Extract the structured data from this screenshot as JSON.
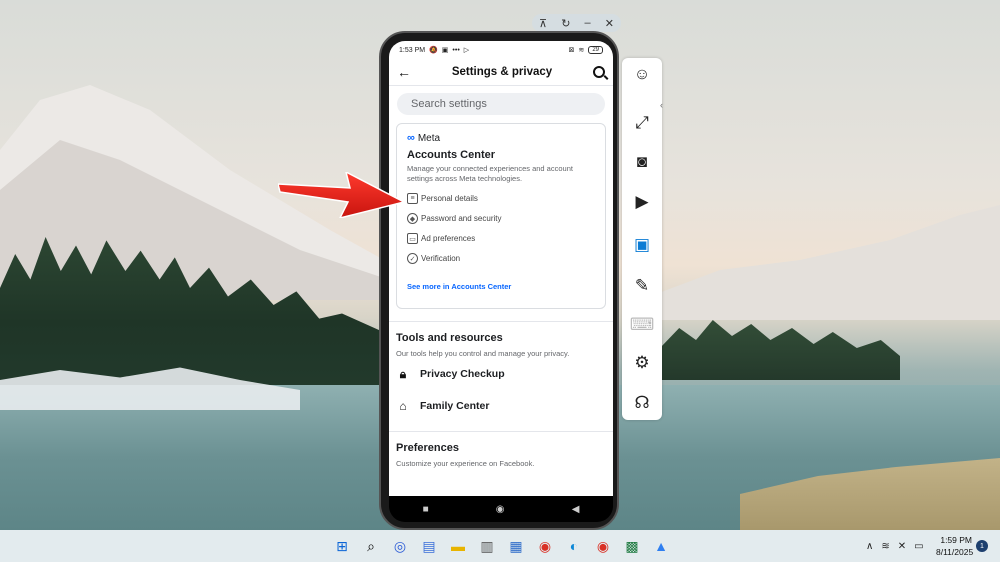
{
  "phone_window": {
    "top_controls": [
      "pin-icon",
      "rotate-icon",
      "minimize-icon",
      "close-icon"
    ]
  },
  "statusbar": {
    "time": "1:53 PM",
    "battery": "29"
  },
  "header": {
    "title": "Settings & privacy"
  },
  "search": {
    "placeholder": "Search settings"
  },
  "accounts_center": {
    "brand": "Meta",
    "title": "Accounts Center",
    "description": "Manage your connected experiences and account settings across Meta technologies.",
    "items": [
      {
        "label": "Personal details",
        "icon": "id-card-icon"
      },
      {
        "label": "Password and security",
        "icon": "shield-icon"
      },
      {
        "label": "Ad preferences",
        "icon": "monitor-icon"
      },
      {
        "label": "Verification",
        "icon": "check-badge-icon"
      }
    ],
    "link": "See more in Accounts Center"
  },
  "tools": {
    "title": "Tools and resources",
    "description": "Our tools help you control and manage your privacy.",
    "items": [
      {
        "label": "Privacy Checkup",
        "icon": "lock-icon"
      },
      {
        "label": "Family Center",
        "icon": "home-people-icon"
      }
    ]
  },
  "preferences": {
    "title": "Preferences",
    "description": "Customize your experience on Facebook."
  },
  "taskbar": {
    "time": "1:59 PM",
    "date": "8/11/2025",
    "notifications": "1"
  },
  "colors": {
    "meta_blue": "#0866ff",
    "arrow_red": "#e0201a"
  }
}
